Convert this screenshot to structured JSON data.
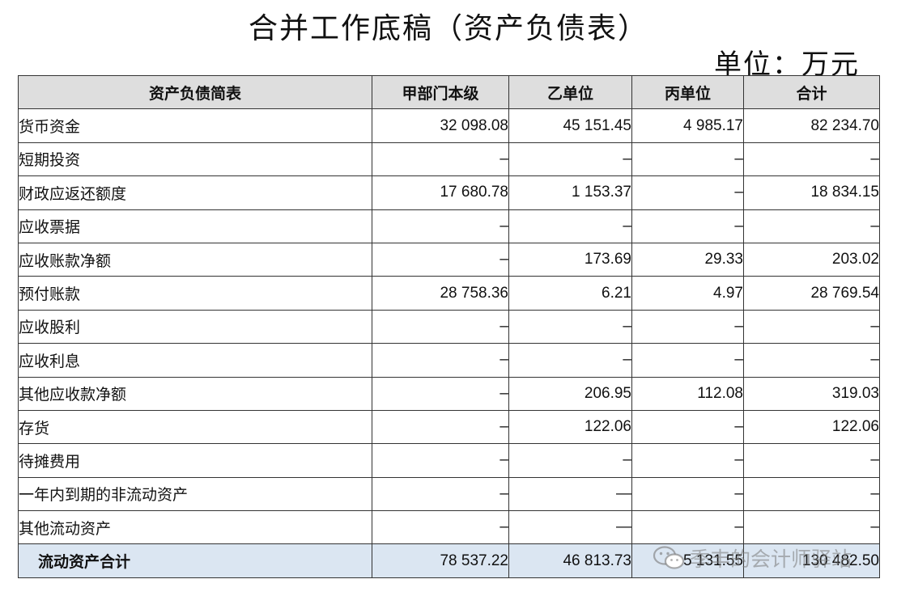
{
  "title": "合并工作底稿（资产负债表）",
  "unit": "单位：万元",
  "table": {
    "headers": [
      "资产负债简表",
      "甲部门本级",
      "乙单位",
      "丙单位",
      "合计"
    ],
    "rows": [
      {
        "label": "货币资金",
        "cells": [
          "32 098.08",
          "45 151.45",
          "4 985.17",
          "82 234.70"
        ]
      },
      {
        "label": "短期投资",
        "cells": [
          "–",
          "–",
          "–",
          "–"
        ]
      },
      {
        "label": "财政应返还额度",
        "cells": [
          "17 680.78",
          "1 153.37",
          "–",
          "18 834.15"
        ]
      },
      {
        "label": "应收票据",
        "cells": [
          "–",
          "–",
          "–",
          "–"
        ]
      },
      {
        "label": "应收账款净额",
        "cells": [
          "–",
          "173.69",
          "29.33",
          "203.02"
        ]
      },
      {
        "label": "预付账款",
        "cells": [
          "28 758.36",
          "6.21",
          "4.97",
          "28 769.54"
        ]
      },
      {
        "label": "应收股利",
        "cells": [
          "–",
          "–",
          "–",
          "–"
        ]
      },
      {
        "label": "应收利息",
        "cells": [
          "–",
          "–",
          "–",
          "–"
        ]
      },
      {
        "label": "其他应收款净额",
        "cells": [
          "–",
          "206.95",
          "112.08",
          "319.03"
        ]
      },
      {
        "label": "存货",
        "cells": [
          "–",
          "122.06",
          "–",
          "122.06"
        ]
      },
      {
        "label": "待摊费用",
        "cells": [
          "–",
          "–",
          "–",
          "–"
        ]
      },
      {
        "label": "一年内到期的非流动资产",
        "cells": [
          "–",
          "—",
          "–",
          "–"
        ]
      },
      {
        "label": "其他流动资产",
        "cells": [
          "–",
          "—",
          "–",
          "–"
        ]
      }
    ],
    "total": {
      "label": "流动资产合计",
      "cells": [
        "78 537.22",
        "46 813.73",
        "5 131.55",
        "130 482.50"
      ]
    }
  },
  "watermark": {
    "text": "季丰的会计师驿站",
    "icon": "wechat-icon"
  }
}
